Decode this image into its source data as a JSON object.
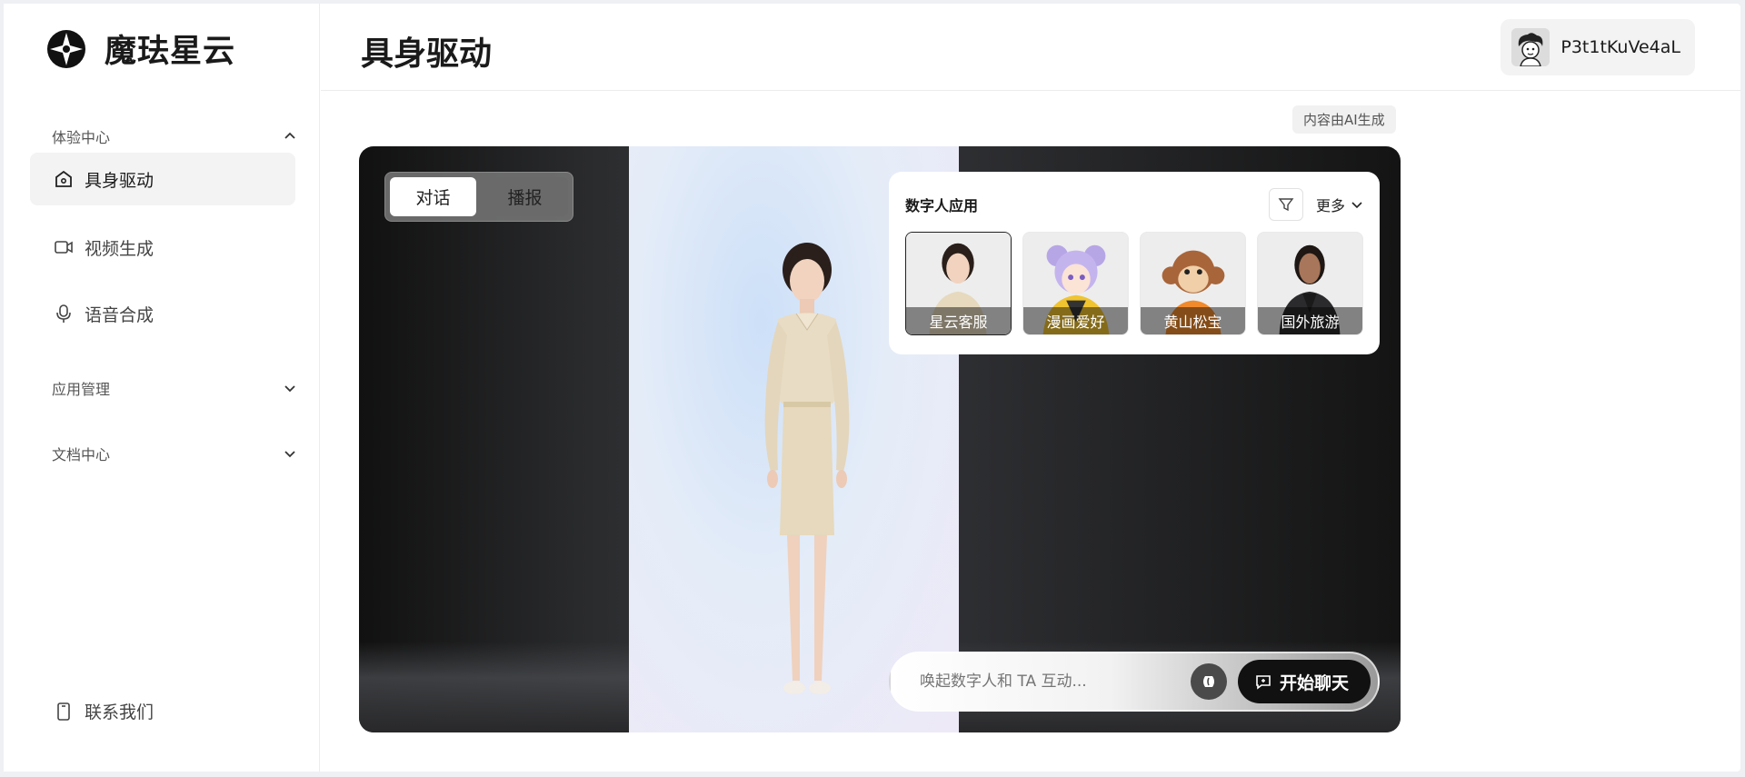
{
  "app": {
    "brand_name": "魔珐星云"
  },
  "header": {
    "title": "具身驱动",
    "user_name": "P3t1tKuVe4aL"
  },
  "sidebar": {
    "sections": [
      {
        "label": "体验中心",
        "expanded": true
      },
      {
        "label": "应用管理",
        "expanded": false
      },
      {
        "label": "文档中心",
        "expanded": false
      }
    ],
    "items": [
      {
        "label": "具身驱动",
        "icon": "home-icon",
        "active": true
      },
      {
        "label": "视频生成",
        "icon": "video-icon",
        "active": false
      },
      {
        "label": "语音合成",
        "icon": "mic-icon",
        "active": false
      }
    ],
    "contact_label": "联系我们"
  },
  "main": {
    "ai_badge": "内容由AI生成",
    "mode_tabs": [
      {
        "label": "对话",
        "active": true
      },
      {
        "label": "播报",
        "active": false
      }
    ],
    "app_card": {
      "title": "数字人应用",
      "more_label": "更多",
      "avatars": [
        {
          "label": "星云客服",
          "selected": true
        },
        {
          "label": "漫画爱好",
          "selected": false
        },
        {
          "label": "黄山松宝",
          "selected": false
        },
        {
          "label": "国外旅游",
          "selected": false
        }
      ]
    },
    "chat": {
      "placeholder": "唤起数字人和 TA 互动...",
      "start_label": "开始聊天"
    }
  },
  "colors": {
    "accent": "#111111",
    "sidebar_active_bg": "#f3f3f3",
    "stage_bg": "#2a2b2d"
  }
}
